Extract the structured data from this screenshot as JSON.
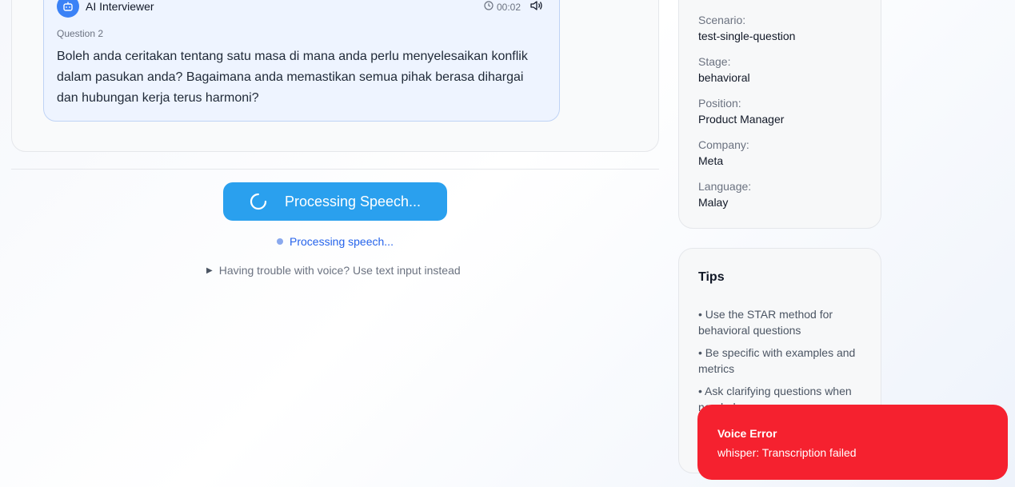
{
  "interviewer": {
    "name": "AI Interviewer",
    "timer": "00:02",
    "question_label": "Question 2",
    "question_text": "Boleh anda ceritakan tentang satu masa di mana anda perlu menyelesaikan konflik dalam pasukan anda? Bagaimana anda memastikan semua pihak berasa dihargai dan hubungan kerja terus harmoni?",
    "avatar_icon": "bot-icon",
    "timer_icon": "clock-icon",
    "audio_icon": "speaker-icon"
  },
  "recorder": {
    "button_label": "Processing Speech...",
    "status": "Processing speech...",
    "text_input_toggle": "Having trouble with voice? Use text input instead"
  },
  "session_info": [
    {
      "label": "Scenario:",
      "value": "test-single-question"
    },
    {
      "label": "Stage:",
      "value": "behavioral"
    },
    {
      "label": "Position:",
      "value": "Product Manager"
    },
    {
      "label": "Company:",
      "value": "Meta"
    },
    {
      "label": "Language:",
      "value": "Malay"
    }
  ],
  "tips": {
    "title": "Tips",
    "items": [
      "• Use the STAR method for behavioral questions",
      "• Be specific with examples and metrics",
      "• Ask clarifying questions when needed"
    ]
  },
  "toast": {
    "title": "Voice Error",
    "message": "whisper: Transcription failed"
  },
  "colors": {
    "accent": "#2aa0ee",
    "avatar": "#3b82f6",
    "error": "#f5212f",
    "status_text": "#2563eb"
  }
}
